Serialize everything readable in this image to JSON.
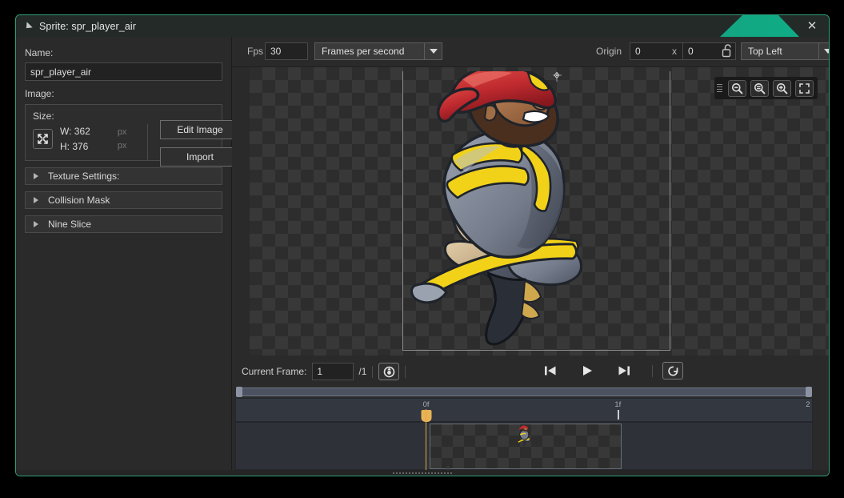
{
  "window": {
    "title": "Sprite: spr_player_air",
    "collapse_icon": "triangle-collapse-icon",
    "close_label": "✕"
  },
  "left_panel": {
    "name_label": "Name:",
    "name_value": "spr_player_air",
    "image_label": "Image:",
    "size_label": "Size:",
    "width_text": "W: 362",
    "height_text": "H: 376",
    "width_unit": "px",
    "height_unit": "px",
    "edit_image_label": "Edit Image",
    "import_label": "Import",
    "sections": [
      {
        "label": "Texture Settings:"
      },
      {
        "label": "Collision Mask"
      },
      {
        "label": "Nine Slice"
      }
    ]
  },
  "toolbar": {
    "fps_label": "Fps",
    "fps_value": "30",
    "playback_mode": "Frames per second",
    "origin_label": "Origin",
    "origin_x": "0",
    "origin_separator": "x",
    "origin_y": "0",
    "lock_icon": "unlocked-padlock-icon",
    "origin_preset": "Top Left"
  },
  "canvas": {
    "zoom_out_icon": "zoom-out-icon",
    "zoom_reset_icon": "zoom-reset-icon",
    "zoom_in_icon": "zoom-in-icon",
    "fit_icon": "fit-to-screen-icon",
    "grip_icon": "drag-grip-icon",
    "origin_icon": "origin-marker-icon",
    "sprite_alt": "firefighter character sprite"
  },
  "frame_bar": {
    "current_frame_label": "Current Frame:",
    "current_frame_value": "1",
    "total_frames": "/1",
    "target_icon": "frame-target-icon",
    "skip_start_icon": "skip-to-start-icon",
    "play_icon": "play-icon",
    "skip_end_icon": "skip-to-end-icon",
    "loop_icon": "loop-toggle-icon"
  },
  "timeline": {
    "ticks": [
      {
        "label": "0f",
        "x_pct": 33.0
      },
      {
        "label": "1f",
        "x_pct": 66.3
      },
      {
        "label": "2",
        "x_pct": 99.6
      }
    ],
    "playhead_label": "0f",
    "scrollbar_icon": "horizontal-scrollbar",
    "drag_handle_icon": "drag-dots-icon"
  },
  "colors": {
    "accent_teal": "#12a07d",
    "playhead_amber": "#e7a93b",
    "panel_bg": "#2a2a2a",
    "canvas_bg": "#2d2d2d",
    "helmet_red": "#c0272d",
    "uniform_gray": "#7b8291",
    "stripe_yellow": "#f2d218",
    "skin_brown": "#a9714b"
  }
}
